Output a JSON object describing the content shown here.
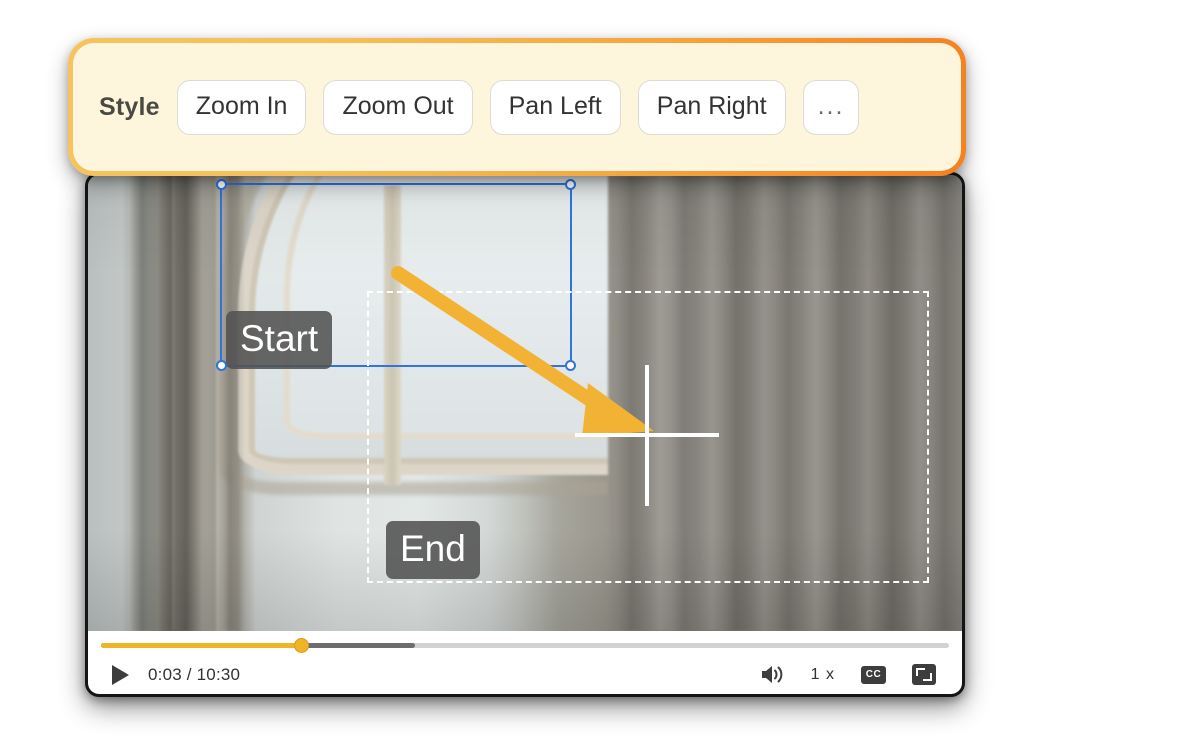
{
  "toolbar": {
    "label": "Style",
    "options": [
      {
        "id": "zoom-in",
        "label": "Zoom In"
      },
      {
        "id": "zoom-out",
        "label": "Zoom Out"
      },
      {
        "id": "pan-left",
        "label": "Pan Left"
      },
      {
        "id": "pan-right",
        "label": "Pan Right"
      },
      {
        "id": "more",
        "label": "..."
      }
    ],
    "border_gradient_from": "#f6c35f",
    "border_gradient_to": "#f58020",
    "background": "#fdf6dd"
  },
  "video": {
    "scene_description": "Interior room with an arched window on the left and grey-beige curtains on the right",
    "start_region_label": "Start",
    "end_region_label": "End",
    "start_region_color": "#2f72e0",
    "end_region_color": "#ffffff",
    "arrow_color": "#f2b233",
    "crosshair_color": "#ffffff",
    "label_background": "#525252"
  },
  "controls": {
    "play_state": "paused",
    "time_current": "0:03",
    "time_separator": "/",
    "time_total": "10:30",
    "time_display": "0:03 / 10:30",
    "progress_played_percent": 23.7,
    "progress_buffered_percent": 37,
    "played_color": "#f0b429",
    "buffered_color": "#6d6d6d",
    "track_color": "#d2d2d2",
    "speed_label": "1 x",
    "cc_label": "CC",
    "volume_state": "on",
    "fullscreen_label": ""
  }
}
